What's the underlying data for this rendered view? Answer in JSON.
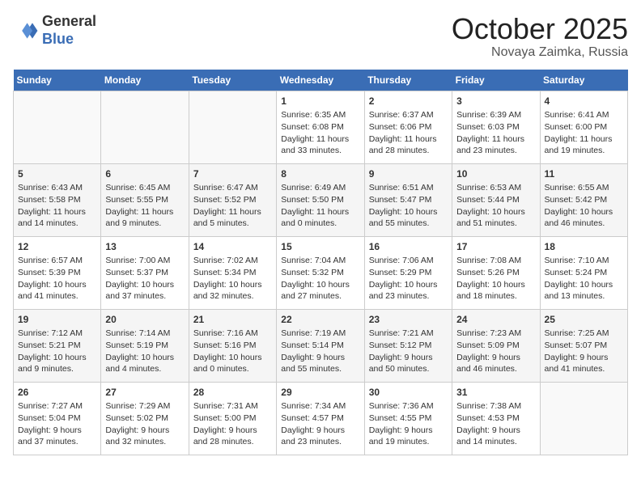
{
  "header": {
    "logo_general": "General",
    "logo_blue": "Blue",
    "month_title": "October 2025",
    "location": "Novaya Zaimka, Russia"
  },
  "weekdays": [
    "Sunday",
    "Monday",
    "Tuesday",
    "Wednesday",
    "Thursday",
    "Friday",
    "Saturday"
  ],
  "weeks": [
    [
      {
        "day": "",
        "content": ""
      },
      {
        "day": "",
        "content": ""
      },
      {
        "day": "",
        "content": ""
      },
      {
        "day": "1",
        "content": "Sunrise: 6:35 AM\nSunset: 6:08 PM\nDaylight: 11 hours\nand 33 minutes."
      },
      {
        "day": "2",
        "content": "Sunrise: 6:37 AM\nSunset: 6:06 PM\nDaylight: 11 hours\nand 28 minutes."
      },
      {
        "day": "3",
        "content": "Sunrise: 6:39 AM\nSunset: 6:03 PM\nDaylight: 11 hours\nand 23 minutes."
      },
      {
        "day": "4",
        "content": "Sunrise: 6:41 AM\nSunset: 6:00 PM\nDaylight: 11 hours\nand 19 minutes."
      }
    ],
    [
      {
        "day": "5",
        "content": "Sunrise: 6:43 AM\nSunset: 5:58 PM\nDaylight: 11 hours\nand 14 minutes."
      },
      {
        "day": "6",
        "content": "Sunrise: 6:45 AM\nSunset: 5:55 PM\nDaylight: 11 hours\nand 9 minutes."
      },
      {
        "day": "7",
        "content": "Sunrise: 6:47 AM\nSunset: 5:52 PM\nDaylight: 11 hours\nand 5 minutes."
      },
      {
        "day": "8",
        "content": "Sunrise: 6:49 AM\nSunset: 5:50 PM\nDaylight: 11 hours\nand 0 minutes."
      },
      {
        "day": "9",
        "content": "Sunrise: 6:51 AM\nSunset: 5:47 PM\nDaylight: 10 hours\nand 55 minutes."
      },
      {
        "day": "10",
        "content": "Sunrise: 6:53 AM\nSunset: 5:44 PM\nDaylight: 10 hours\nand 51 minutes."
      },
      {
        "day": "11",
        "content": "Sunrise: 6:55 AM\nSunset: 5:42 PM\nDaylight: 10 hours\nand 46 minutes."
      }
    ],
    [
      {
        "day": "12",
        "content": "Sunrise: 6:57 AM\nSunset: 5:39 PM\nDaylight: 10 hours\nand 41 minutes."
      },
      {
        "day": "13",
        "content": "Sunrise: 7:00 AM\nSunset: 5:37 PM\nDaylight: 10 hours\nand 37 minutes."
      },
      {
        "day": "14",
        "content": "Sunrise: 7:02 AM\nSunset: 5:34 PM\nDaylight: 10 hours\nand 32 minutes."
      },
      {
        "day": "15",
        "content": "Sunrise: 7:04 AM\nSunset: 5:32 PM\nDaylight: 10 hours\nand 27 minutes."
      },
      {
        "day": "16",
        "content": "Sunrise: 7:06 AM\nSunset: 5:29 PM\nDaylight: 10 hours\nand 23 minutes."
      },
      {
        "day": "17",
        "content": "Sunrise: 7:08 AM\nSunset: 5:26 PM\nDaylight: 10 hours\nand 18 minutes."
      },
      {
        "day": "18",
        "content": "Sunrise: 7:10 AM\nSunset: 5:24 PM\nDaylight: 10 hours\nand 13 minutes."
      }
    ],
    [
      {
        "day": "19",
        "content": "Sunrise: 7:12 AM\nSunset: 5:21 PM\nDaylight: 10 hours\nand 9 minutes."
      },
      {
        "day": "20",
        "content": "Sunrise: 7:14 AM\nSunset: 5:19 PM\nDaylight: 10 hours\nand 4 minutes."
      },
      {
        "day": "21",
        "content": "Sunrise: 7:16 AM\nSunset: 5:16 PM\nDaylight: 10 hours\nand 0 minutes."
      },
      {
        "day": "22",
        "content": "Sunrise: 7:19 AM\nSunset: 5:14 PM\nDaylight: 9 hours\nand 55 minutes."
      },
      {
        "day": "23",
        "content": "Sunrise: 7:21 AM\nSunset: 5:12 PM\nDaylight: 9 hours\nand 50 minutes."
      },
      {
        "day": "24",
        "content": "Sunrise: 7:23 AM\nSunset: 5:09 PM\nDaylight: 9 hours\nand 46 minutes."
      },
      {
        "day": "25",
        "content": "Sunrise: 7:25 AM\nSunset: 5:07 PM\nDaylight: 9 hours\nand 41 minutes."
      }
    ],
    [
      {
        "day": "26",
        "content": "Sunrise: 7:27 AM\nSunset: 5:04 PM\nDaylight: 9 hours\nand 37 minutes."
      },
      {
        "day": "27",
        "content": "Sunrise: 7:29 AM\nSunset: 5:02 PM\nDaylight: 9 hours\nand 32 minutes."
      },
      {
        "day": "28",
        "content": "Sunrise: 7:31 AM\nSunset: 5:00 PM\nDaylight: 9 hours\nand 28 minutes."
      },
      {
        "day": "29",
        "content": "Sunrise: 7:34 AM\nSunset: 4:57 PM\nDaylight: 9 hours\nand 23 minutes."
      },
      {
        "day": "30",
        "content": "Sunrise: 7:36 AM\nSunset: 4:55 PM\nDaylight: 9 hours\nand 19 minutes."
      },
      {
        "day": "31",
        "content": "Sunrise: 7:38 AM\nSunset: 4:53 PM\nDaylight: 9 hours\nand 14 minutes."
      },
      {
        "day": "",
        "content": ""
      }
    ]
  ]
}
